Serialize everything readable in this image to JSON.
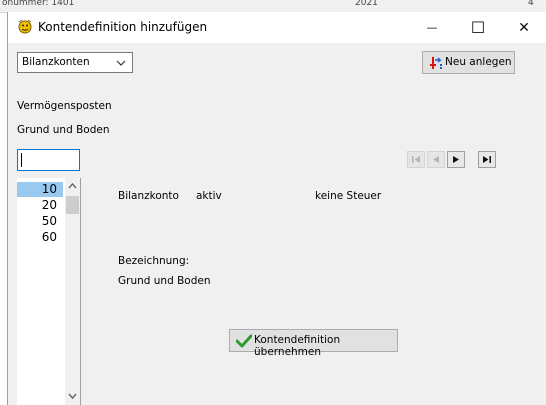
{
  "background_strip": {
    "left_text": "onummer: 1401",
    "mid_text": "2021",
    "right_text": "4"
  },
  "window": {
    "title": "Kontendefinition hinzufügen",
    "controls": {
      "minimize": "—",
      "maximize": "☐",
      "close": "✕"
    }
  },
  "toolbar": {
    "account_type_value": "Bilanzkonten",
    "new_button_label": "Neu anlegen"
  },
  "category": {
    "group": "Vermögensposten",
    "item": "Grund und Boden"
  },
  "search": {
    "value": ""
  },
  "navigation": {
    "first": "disabled",
    "previous": "disabled",
    "next": "enabled",
    "last": "enabled"
  },
  "account_list": {
    "items": [
      "10",
      "20",
      "50",
      "60"
    ],
    "selected_index": 0
  },
  "details": {
    "account_kind": "Bilanzkonto",
    "side": "aktiv",
    "tax": "keine Steuer",
    "description_label": "Bezeichnung:",
    "description_value": "Grund und Boden"
  },
  "apply_button_label": "Kontendefinition übernehmen",
  "colors": {
    "selection": "#99c9ef",
    "focus_border": "#0078d7",
    "window_bg": "#f0f0f0",
    "check_green": "#2e9b2e"
  }
}
